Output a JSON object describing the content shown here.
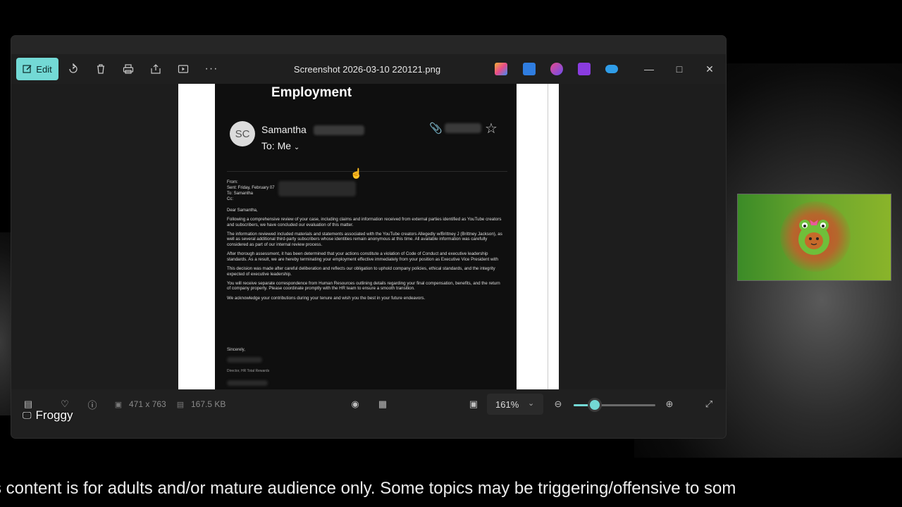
{
  "window": {
    "title": "Screenshot 2026-03-10 220121.png",
    "edit_label": "Edit"
  },
  "toolbar_icons": [
    "edit-icon",
    "rotate-icon",
    "delete-icon",
    "print-icon",
    "share-icon",
    "slideshow-icon",
    "more-icon"
  ],
  "app_icons": [
    "copilot-icon",
    "photo-editor-icon",
    "designer-icon",
    "clipchamp-icon",
    "onedrive-icon"
  ],
  "document": {
    "heading": "Employment",
    "avatar_initials": "SC",
    "sender": "Samantha",
    "recipient": "To: Me",
    "meta_from": "From:",
    "meta_sent": "Sent: Friday, February 07",
    "meta_to": "To: Samantha",
    "meta_cc": "Cc:",
    "greeting": "Dear Samantha,",
    "paragraphs": [
      "Following a comprehensive review of your case, including claims and information received from external parties identified as YouTube creators and subscribers, we have concluded our evaluation of this matter.",
      "The information reviewed included materials and statements associated with the YouTube creators Allegedly w/Brittney J (Brittney Jackson), as well as several additional third-party subscribers whose identities remain anonymous at this time. All available information was carefully considered as part of our internal review process.",
      "After thorough assessment, it has been determined that your actions constitute a violation of Code of Conduct and executive leadership standards. As a result, we are hereby terminating your employment effective immediately from your position as Executive Vice President with",
      "This decision was made after careful deliberation and reflects our obligation to uphold company policies, ethical standards, and the integrity expected of executive leadership.",
      "You will receive separate correspondence from Human Resources outlining details regarding your final compensation, benefits, and the return of company property. Please coordinate promptly with the HR team to ensure a smooth transition.",
      "We acknowledge your contributions during your tenure and wish you the best in your future endeavors."
    ],
    "closing": "Sincerely,",
    "signature_title": "Director, HR Total Rewards"
  },
  "statusbar": {
    "dimensions": "471 x 763",
    "file_size": "167.5 KB",
    "zoom": "161%",
    "zoom_level": 0.26
  },
  "overlay": {
    "streamer_name": "Froggy",
    "ticker": "s content is for adults and/or mature audience only. Some topics may be triggering/offensive to som"
  },
  "colors": {
    "accent": "#73d9d5",
    "window_bg": "#202020",
    "document_bg": "#0f0f0f"
  }
}
